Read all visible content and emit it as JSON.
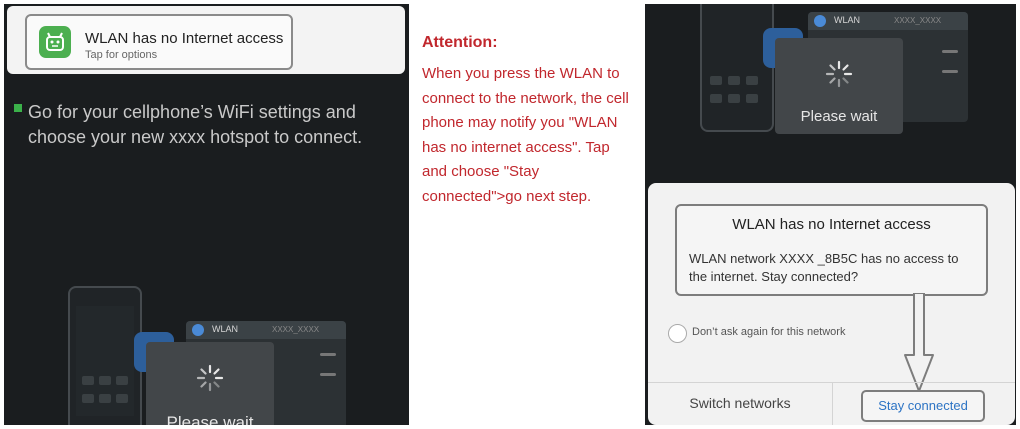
{
  "left_panel": {
    "notification": {
      "title": "WLAN has no Internet access",
      "subtitle": "Tap for options",
      "app_icon": "android-icon"
    },
    "instruction": "Go for your cellphone’s WiFi settings and choose your new  xxxx  hotspot to connect.",
    "wlan_card": {
      "label": "WLAN",
      "network": "XXXX_XXXX"
    },
    "wait_text": "Please wait"
  },
  "middle_panel": {
    "title": "Attention:",
    "body": "When you press the WLAN to connect to the network, the cell phone may notify you \"WLAN has no internet access\". Tap and choose \"Stay connected\">go next step."
  },
  "right_panel": {
    "wlan_card": {
      "label": "WLAN",
      "network": "XXXX_XXXX"
    },
    "wait_text": "Please wait",
    "dialog": {
      "title": "WLAN has no Internet access",
      "body": "WLAN network XXXX _8B5C has no access to the internet. Stay connected?",
      "dont_ask": "Don’t ask again for this network",
      "switch_label": "Switch networks",
      "stay_label": "Stay connected"
    }
  },
  "colors": {
    "attention_red": "#c1272d",
    "accent_blue": "#2d74c4",
    "android_green": "#4caf50"
  }
}
